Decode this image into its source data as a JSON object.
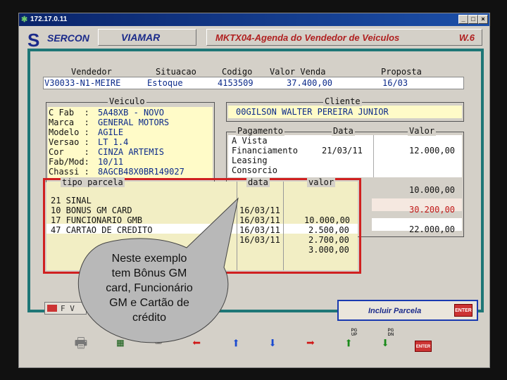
{
  "window": {
    "title": "172.17.0.11"
  },
  "header": {
    "brand": "SERCON",
    "company": "VIAMAR",
    "screen_title": "MKTX04-Agenda do Vendedor de Veiculos",
    "version": "W.6"
  },
  "top": {
    "headers": [
      "Vendedor",
      "Situacao",
      "Codigo",
      "Valor Venda",
      "Proposta"
    ],
    "vendedor": "V30033-N1-MEIRE",
    "situacao": "Estoque",
    "codigo": "4153509",
    "valor_venda": "37.400,00",
    "proposta": "16/03"
  },
  "veiculo": {
    "title": "Veiculo",
    "rows": [
      {
        "label": "C Fab  :",
        "value": "5A48XB - NOVO"
      },
      {
        "label": "Marca  :",
        "value": "GENERAL MOTORS"
      },
      {
        "label": "Modelo :",
        "value": "AGILE"
      },
      {
        "label": "Versao :",
        "value": "LT 1.4"
      },
      {
        "label": "Cor    :",
        "value": "CINZA ARTEMIS"
      },
      {
        "label": "Fab/Mod:",
        "value": "10/11"
      },
      {
        "label": "Chassi :",
        "value": "8AGCB48X0BR149027"
      }
    ]
  },
  "cliente": {
    "title": "Cliente",
    "value": "00GILSON WALTER PEREIRA JUNIOR"
  },
  "pagamento": {
    "headers": [
      "Pagamento",
      "Data",
      "Valor"
    ],
    "rows": [
      {
        "tipo": "A Vista",
        "data": "",
        "valor": ""
      },
      {
        "tipo": "Financiamento",
        "data": "21/03/11",
        "valor": "12.000,00"
      },
      {
        "tipo": "Leasing",
        "data": "",
        "valor": ""
      },
      {
        "tipo": "Consorcio",
        "data": "",
        "valor": ""
      }
    ],
    "extra_values": [
      "10.000,00",
      "30.200,00",
      "22.000,00"
    ]
  },
  "parcelas": {
    "headers": [
      "tipo parcela",
      "data",
      "valor"
    ],
    "rows": [
      {
        "tipo": "21 SINAL",
        "data": "16/03/11",
        "valor": "10.000,00"
      },
      {
        "tipo": "10 BONUS GM CARD",
        "data": "16/03/11",
        "valor": "2.500,00"
      },
      {
        "tipo": "17 FUNCIONARIO GMB",
        "data": "16/03/11",
        "valor": "2.700,00"
      },
      {
        "tipo": "47 CARTAO DE CREDITO",
        "data": "16/03/11",
        "valor": "3.000,00"
      }
    ]
  },
  "buttons": {
    "incluir": "Incluir Parcela",
    "incluir_icon": "ENTER",
    "left_label": "F V",
    "toolbar_icons": [
      "printer-icon",
      "calculator-icon",
      "keyboard-icon",
      "arrow-left-icon",
      "arrow-up-icon",
      "arrow-down-icon",
      "arrow-right-icon",
      "page-up-icon",
      "page-down-icon",
      "enter-icon"
    ],
    "pgup_label": "PG UP",
    "pgdn_label": "PG DN",
    "enter_label": "ENTER"
  },
  "callout": {
    "lines": [
      "Neste exemplo",
      "tem Bônus GM",
      "card, Funcionário",
      "GM e Cartão de",
      "crédito"
    ]
  },
  "colors": {
    "accent_red": "#d02020",
    "field_blue": "#0b2a8a",
    "teal": "#1e7676"
  }
}
